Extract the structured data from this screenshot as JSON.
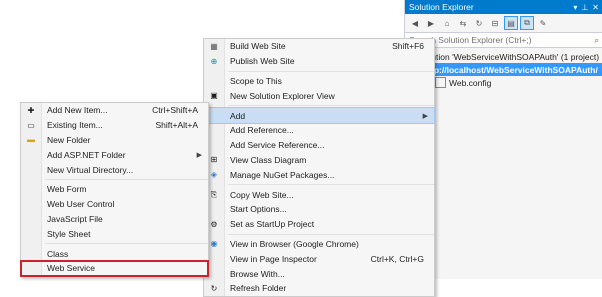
{
  "solution_explorer": {
    "title": "Solution Explorer",
    "search_placeholder": "Search Solution Explorer (Ctrl+;)",
    "tree": [
      {
        "label": "Solution 'WebServiceWithSOAPAuth' (1 project)",
        "selected": false
      },
      {
        "label": "http://localhost/WebServiceWithSOAPAuth/",
        "selected": true
      },
      {
        "label": "Web.config",
        "selected": false
      }
    ]
  },
  "main_menu": {
    "items": [
      {
        "label": "Build Web Site",
        "shortcut": "Shift+F6",
        "icon": "build-icon"
      },
      {
        "label": "Publish Web Site",
        "icon": "publish-icon"
      },
      {
        "sep": true
      },
      {
        "label": "Scope to This"
      },
      {
        "label": "New Solution Explorer View",
        "icon": "new-view-icon"
      },
      {
        "sep": true
      },
      {
        "label": "Add",
        "submenu": true,
        "highlighted": true
      },
      {
        "label": "Add Reference..."
      },
      {
        "label": "Add Service Reference..."
      },
      {
        "label": "View Class Diagram",
        "icon": "class-diagram-icon"
      },
      {
        "label": "Manage NuGet Packages...",
        "icon": "nuget-icon"
      },
      {
        "sep": true
      },
      {
        "label": "Copy Web Site...",
        "icon": "copy-site-icon"
      },
      {
        "label": "Start Options..."
      },
      {
        "label": "Set as StartUp Project",
        "icon": "startup-gear-icon"
      },
      {
        "sep": true
      },
      {
        "label": "View in Browser (Google Chrome)",
        "icon": "browser-icon"
      },
      {
        "label": "View in Page Inspector",
        "shortcut": "Ctrl+K, Ctrl+G"
      },
      {
        "label": "Browse With..."
      },
      {
        "label": "Refresh Folder",
        "icon": "refresh-icon"
      }
    ]
  },
  "add_submenu": {
    "items": [
      {
        "label": "Add New Item...",
        "shortcut": "Ctrl+Shift+A",
        "icon": "new-item-icon"
      },
      {
        "label": "Existing Item...",
        "shortcut": "Shift+Alt+A",
        "icon": "existing-item-icon"
      },
      {
        "label": "New Folder",
        "icon": "folder-icon"
      },
      {
        "label": "Add ASP.NET Folder",
        "submenu": true
      },
      {
        "label": "New Virtual Directory..."
      },
      {
        "sep": true
      },
      {
        "label": "Web Form"
      },
      {
        "label": "Web User Control"
      },
      {
        "label": "JavaScript File"
      },
      {
        "label": "Style Sheet"
      },
      {
        "sep": true
      },
      {
        "label": "Class"
      },
      {
        "label": "Web Service",
        "boxed": true
      }
    ]
  },
  "colors": {
    "accent": "#007acc",
    "selection": "#3399ff",
    "highlight_box": "#c8242a"
  }
}
